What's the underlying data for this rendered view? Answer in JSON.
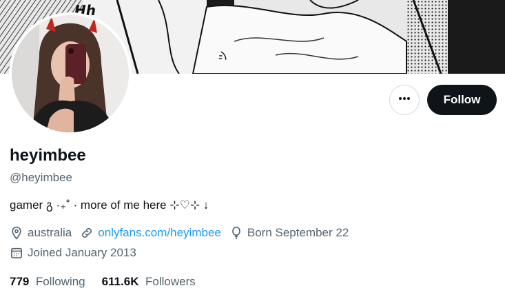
{
  "banner": {
    "comic_text_1": "Hh",
    "comic_text_2": "ッ"
  },
  "actions": {
    "follow_label": "Follow"
  },
  "profile": {
    "display_name": "heyimbee",
    "handle": "@heyimbee",
    "bio": "gamer გ ·₊˚ · more of me here ⊹♡⊹ ↓"
  },
  "meta": {
    "location": "australia",
    "website": "onlyfans.com/heyimbee",
    "birthday": "Born September 22",
    "joined": "Joined January 2013"
  },
  "stats": {
    "following_count": "779",
    "following_label": "Following",
    "followers_count": "611.6K",
    "followers_label": "Followers"
  },
  "icons": [
    "location-icon",
    "link-icon",
    "balloon-icon",
    "calendar-icon",
    "more-icon"
  ],
  "colors": {
    "link": "#1d9bf0",
    "secondary_text": "#536471",
    "button": "#0f1419"
  }
}
